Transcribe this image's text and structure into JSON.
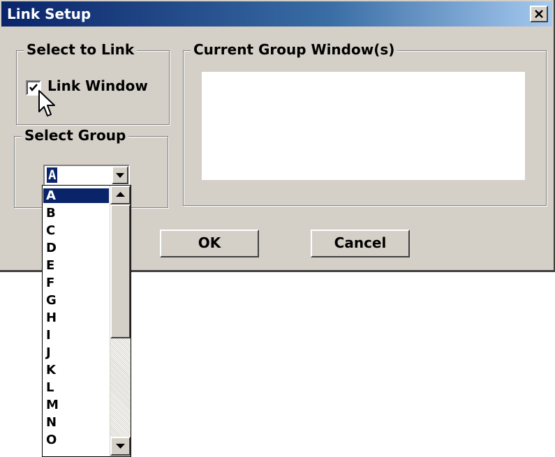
{
  "window": {
    "title": "Link Setup",
    "close_label": "x"
  },
  "select_to_link": {
    "legend": "Select to Link",
    "checkbox_label": "Link Window",
    "checked": true
  },
  "current_group": {
    "legend": "Current Group Window(s)",
    "items": []
  },
  "select_group": {
    "legend": "Select Group",
    "selected_value": "A",
    "options": [
      "A",
      "B",
      "C",
      "D",
      "E",
      "F",
      "G",
      "H",
      "I",
      "J",
      "K",
      "L",
      "M",
      "N",
      "O"
    ]
  },
  "buttons": {
    "ok_label": "OK",
    "cancel_label": "Cancel"
  },
  "icons": {
    "checkmark": "checkmark-icon",
    "dropdown_arrow": "chevron-down-icon",
    "scroll_up": "arrow-up-icon",
    "scroll_down": "arrow-down-icon",
    "cursor": "mouse-pointer-icon"
  },
  "colors": {
    "titlebar_start": "#0a246a",
    "titlebar_end": "#a6caf0",
    "selection": "#0a246a",
    "face": "#d4d0c8"
  }
}
